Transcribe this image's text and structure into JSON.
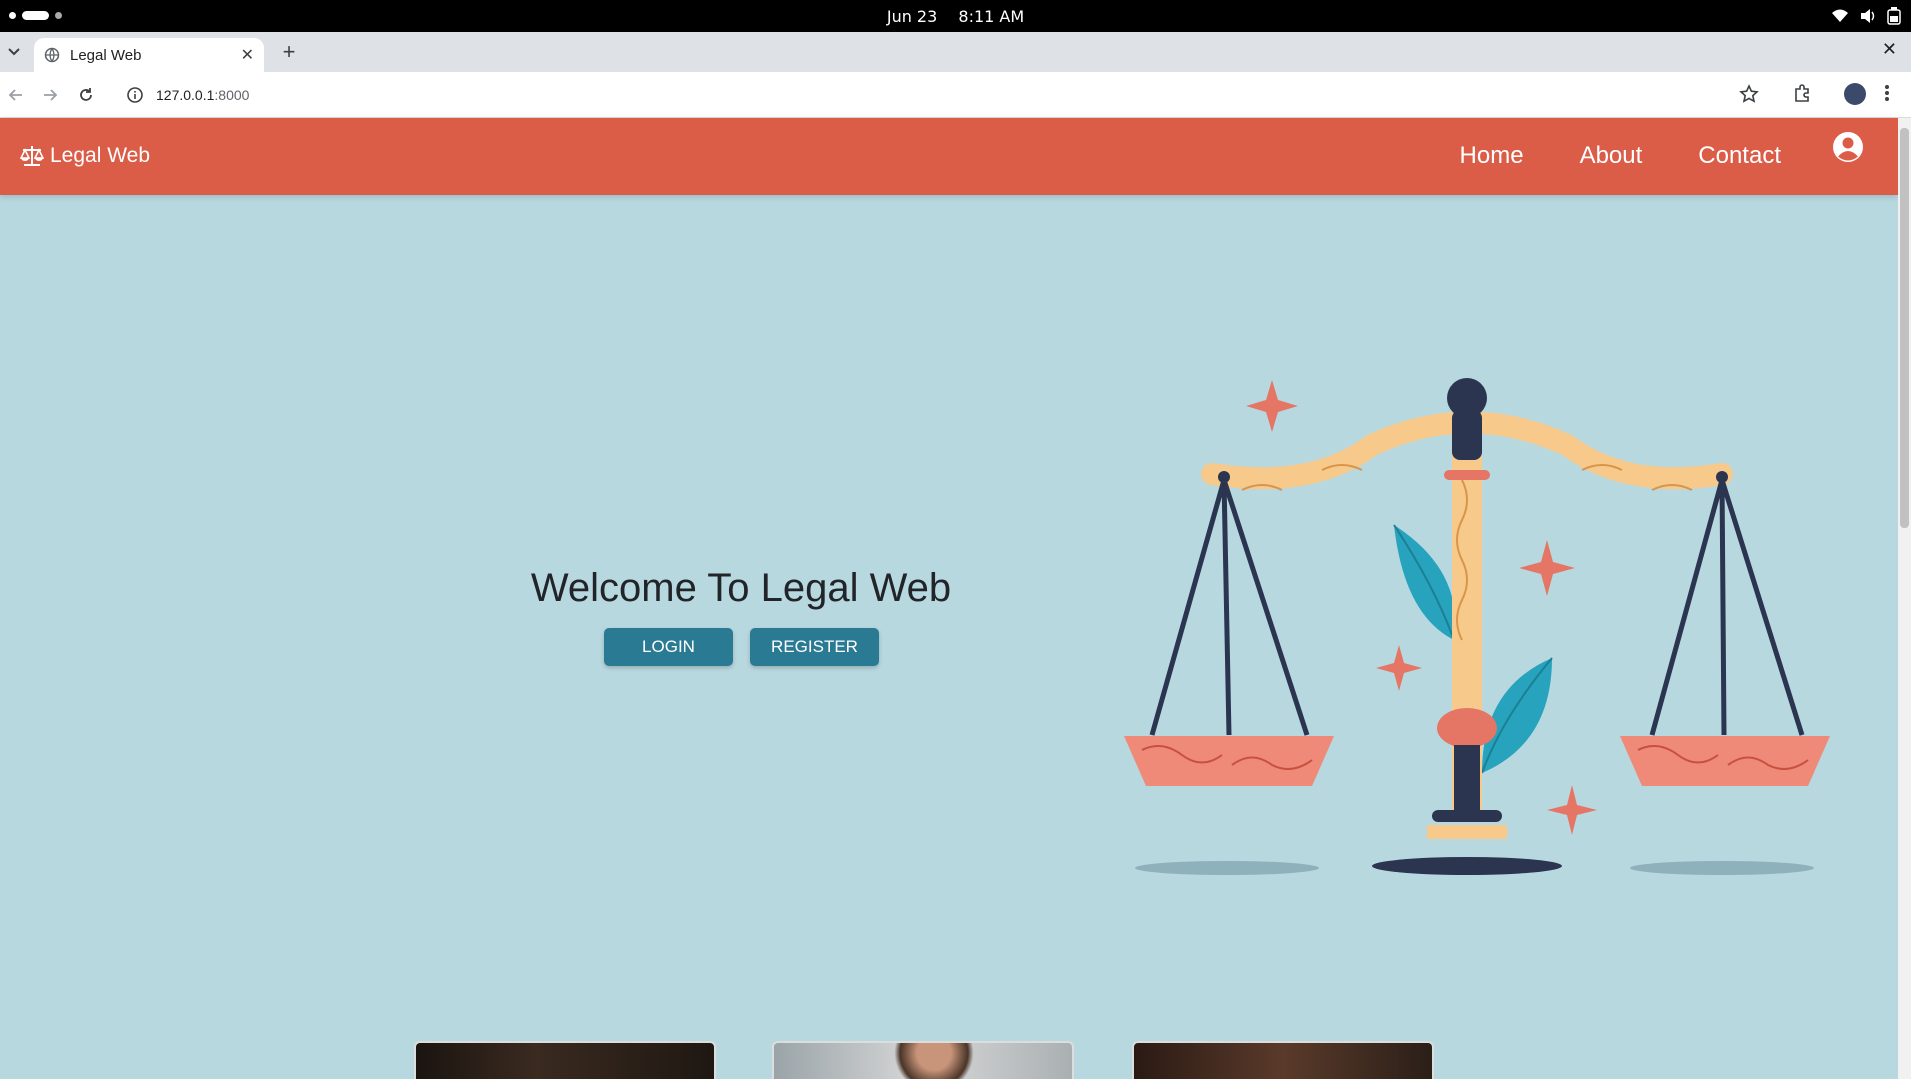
{
  "os": {
    "date": "Jun 23",
    "time": "8:11 AM"
  },
  "browser": {
    "tab_title": "Legal Web",
    "url_host": "127.0.0.1",
    "url_port": ":8000"
  },
  "navbar": {
    "brand": "Legal Web",
    "links": [
      "Home",
      "About",
      "Contact"
    ],
    "color": "#db5d48"
  },
  "hero": {
    "title": "Welcome To Legal Web",
    "login_label": "LOGIN",
    "register_label": "REGISTER",
    "background": "#b8d8e0",
    "button_color": "#2b7a94"
  },
  "icons": {
    "brand_icon": "scale-balance-icon",
    "user_icon": "user-circle-icon"
  }
}
